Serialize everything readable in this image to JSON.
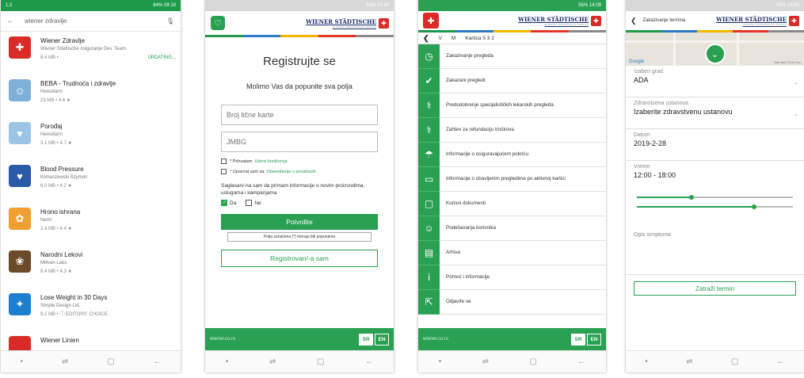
{
  "phone1": {
    "status_left": "1:2",
    "status_right": "84% 09:18",
    "search_value": "wiener zdravlje",
    "apps": [
      {
        "name": "Wiener Zdravlje",
        "dev": "Wiener Städtische osiguranje Dev. Team",
        "meta": "8.4 MB •",
        "extra": "UPDATING...",
        "icon": "wiener-zdravlje-icon",
        "glyph": "✚",
        "color": "#d92b28"
      },
      {
        "name": "BEBA - Trudnoća i zdravlje",
        "dev": "Hemofarm",
        "meta": "23 MB • 4.6 ★",
        "extra": "",
        "icon": "beba-icon",
        "glyph": "☺",
        "color": "#7fb0d8"
      },
      {
        "name": "Porođaj",
        "dev": "Hemofarm",
        "meta": "3.1 MB • 4.7 ★",
        "extra": "",
        "icon": "porodaj-icon",
        "glyph": "♥",
        "color": "#9cc4e4"
      },
      {
        "name": "Blood Pressure",
        "dev": "Klimaszewski Szymon",
        "meta": "6.0 MB • 4.2 ★",
        "extra": "",
        "icon": "blood-pressure-icon",
        "glyph": "♥",
        "color": "#2a5aa8"
      },
      {
        "name": "Hrono ishrana",
        "dev": "Nemi",
        "meta": "2.4 MB • 4.4 ★",
        "extra": "",
        "icon": "hrono-ishrana-icon",
        "glyph": "✿",
        "color": "#f0a030"
      },
      {
        "name": "Narodni Lekovi",
        "dev": "Milivan Labs",
        "meta": "8.4 MB • 4.3 ★",
        "extra": "",
        "icon": "narodni-lekovi-icon",
        "glyph": "❀",
        "color": "#6a4a2a"
      },
      {
        "name": "Lose Weight in 30 Days",
        "dev": "Simple Design Ltd.",
        "meta": "9.2 MB • ⓘ EDITORS' CHOICE",
        "extra": "",
        "icon": "lose-weight-icon",
        "glyph": "✦",
        "color": "#1d7fd0"
      },
      {
        "name": "Wiener Linien",
        "dev": "",
        "meta": "",
        "extra": "",
        "icon": "wiener-linien-icon",
        "glyph": "",
        "color": "#d92b28"
      }
    ]
  },
  "brand": {
    "name": "WIENER STÄDTISCHE",
    "sub": "VIENNA INSURANCE GROUP"
  },
  "phone2": {
    "status_right": "90% 13:44",
    "title": "Registrujte se",
    "subtitle": "Molimo Vas da popunite sva polja",
    "id_placeholder": "Broj lične karte",
    "jmbg_placeholder": "JMBG",
    "check1_text": "* Prihvatam",
    "check1_link": "Uslovi korišćenja",
    "check2_text": "* Upoznat sam sa",
    "check2_link": "Obaveštenje o privatnosti",
    "agree_text": "Saglasan/-na sam da primam informacije o novim proizvodima, uslugama i kampanjama",
    "yes": "Da",
    "no": "Ne",
    "confirm": "Potvrdite",
    "required_note": "Polja označena (*) moraju biti popunjena",
    "registered": "Registrovan/-a sam",
    "footer_url": "wiener.co.rs",
    "lang_sr": "SR",
    "lang_en": "EN"
  },
  "phone3": {
    "status_right": "55% 14:09",
    "sub_left": "V",
    "sub_mid": "M",
    "sub_card": "Kartica 5 3 2",
    "menu": [
      {
        "label": "Zakazivanje pregleda",
        "icon": "clock-icon",
        "glyph": "◷"
      },
      {
        "label": "Zakazani pregledi",
        "icon": "checklist-icon",
        "glyph": "✔"
      },
      {
        "label": "Predodobrenje specijalističkih lekarskih pregleda",
        "icon": "doctor-approval-icon",
        "glyph": "⚕"
      },
      {
        "label": "Zahtev za refundaciju troškova",
        "icon": "refund-icon",
        "glyph": "⚕"
      },
      {
        "label": "Informacije o osiguravajućem pokriću",
        "icon": "umbrella-icon",
        "glyph": "☂"
      },
      {
        "label": "Informacije o obavljenim pregledima po aktivnoj kartici",
        "icon": "card-icon",
        "glyph": "▭"
      },
      {
        "label": "Korisni dokumenti",
        "icon": "folder-icon",
        "glyph": "▢"
      },
      {
        "label": "Podešavanja korisnika",
        "icon": "user-icon",
        "glyph": "☺"
      },
      {
        "label": "Arhiva",
        "icon": "archive-icon",
        "glyph": "▤"
      },
      {
        "label": "Pomoć i informacije",
        "icon": "info-icon",
        "glyph": "ⅰ"
      },
      {
        "label": "Odjavite se",
        "icon": "logout-icon",
        "glyph": "⇱"
      }
    ],
    "footer_url": "wiener.co.rs",
    "lang_sr": "SR",
    "lang_en": "EN"
  },
  "phone4": {
    "status_right": "50% 15:02",
    "title": "Zakazivanje termina",
    "map_google": "Google",
    "map_copyright": "Map data ©2019 Goo",
    "city_label": "Izaberi grad",
    "city_value": "ADA",
    "inst_label": "Zdravstvena ustanova",
    "inst_value": "Izaberite zdravstvenu ustanovu",
    "date_label": "Datum",
    "date_value": "2019-2-28",
    "time_label": "Vreme",
    "time_value": "12:00 - 18:00",
    "slider1": 0.35,
    "slider2": 0.75,
    "symptom_label": "Opis simptoma",
    "submit": "Zatraži termin"
  }
}
